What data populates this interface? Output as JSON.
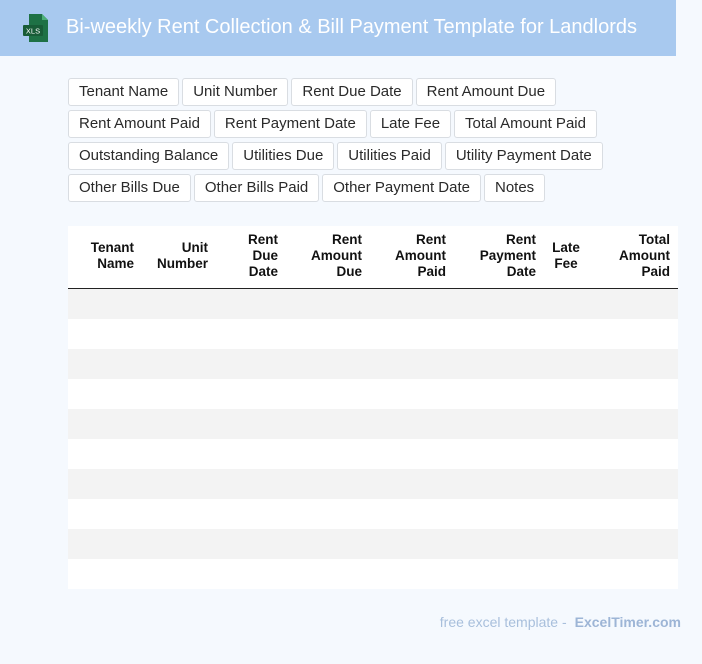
{
  "header": {
    "title": "Bi-weekly Rent Collection & Bill Payment Template for Landlords",
    "icon": "xls-file-icon",
    "icon_label": "XLS",
    "icon_color": "#1e7145",
    "background": "#a8c9ef"
  },
  "fields": [
    "Tenant Name",
    "Unit Number",
    "Rent Due Date",
    "Rent Amount Due",
    "Rent Amount Paid",
    "Rent Payment Date",
    "Late Fee",
    "Total Amount Paid",
    "Outstanding Balance",
    "Utilities Due",
    "Utilities Paid",
    "Utility Payment Date",
    "Other Bills Due",
    "Other Bills Paid",
    "Other Payment Date",
    "Notes"
  ],
  "table": {
    "columns": [
      {
        "line1": "Tenant",
        "line2": "Name",
        "line3": ""
      },
      {
        "line1": "Unit",
        "line2": "Number",
        "line3": ""
      },
      {
        "line1": "Rent",
        "line2": "Due",
        "line3": "Date"
      },
      {
        "line1": "Rent",
        "line2": "Amount",
        "line3": "Due"
      },
      {
        "line1": "Rent",
        "line2": "Amount",
        "line3": "Paid"
      },
      {
        "line1": "Rent",
        "line2": "Payment",
        "line3": "Date"
      },
      {
        "line1": "Late",
        "line2": "Fee",
        "line3": ""
      },
      {
        "line1": "Total",
        "line2": "Amount",
        "line3": "Paid"
      }
    ],
    "row_count": 10
  },
  "footer": {
    "text": "free excel template -",
    "brand": "ExcelTimer.com"
  }
}
